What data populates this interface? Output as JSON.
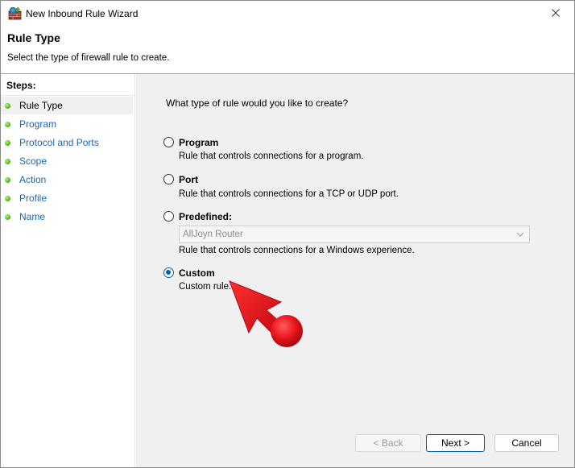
{
  "window": {
    "title": "New Inbound Rule Wizard"
  },
  "header": {
    "title": "Rule Type",
    "description": "Select the type of firewall rule to create."
  },
  "sidebar": {
    "steps_label": "Steps:",
    "items": [
      {
        "label": "Rule Type",
        "active": true
      },
      {
        "label": "Program"
      },
      {
        "label": "Protocol and Ports"
      },
      {
        "label": "Scope"
      },
      {
        "label": "Action"
      },
      {
        "label": "Profile"
      },
      {
        "label": "Name"
      }
    ]
  },
  "main": {
    "question": "What type of rule would you like to create?",
    "options": [
      {
        "label": "Program",
        "description": "Rule that controls connections for a program.",
        "checked": false
      },
      {
        "label": "Port",
        "description": "Rule that controls connections for a TCP or UDP port.",
        "checked": false
      },
      {
        "label": "Predefined:",
        "description": "Rule that controls connections for a Windows experience.",
        "checked": false
      },
      {
        "label": "Custom",
        "description": "Custom rule.",
        "checked": true
      }
    ],
    "predefined_dropdown": {
      "selected": "AllJoyn Router"
    }
  },
  "footer": {
    "back_label": "< Back",
    "next_label": "Next >",
    "cancel_label": "Cancel"
  },
  "colors": {
    "accent": "#0063b1",
    "link": "#1a66b8",
    "annotation": "#e8121b"
  },
  "icons": {
    "app": "firewall-wizard-icon",
    "close": "close-icon",
    "step": "green-dot-icon",
    "dropdown": "chevron-down-icon",
    "annotation": "red-arrow-pointer"
  }
}
